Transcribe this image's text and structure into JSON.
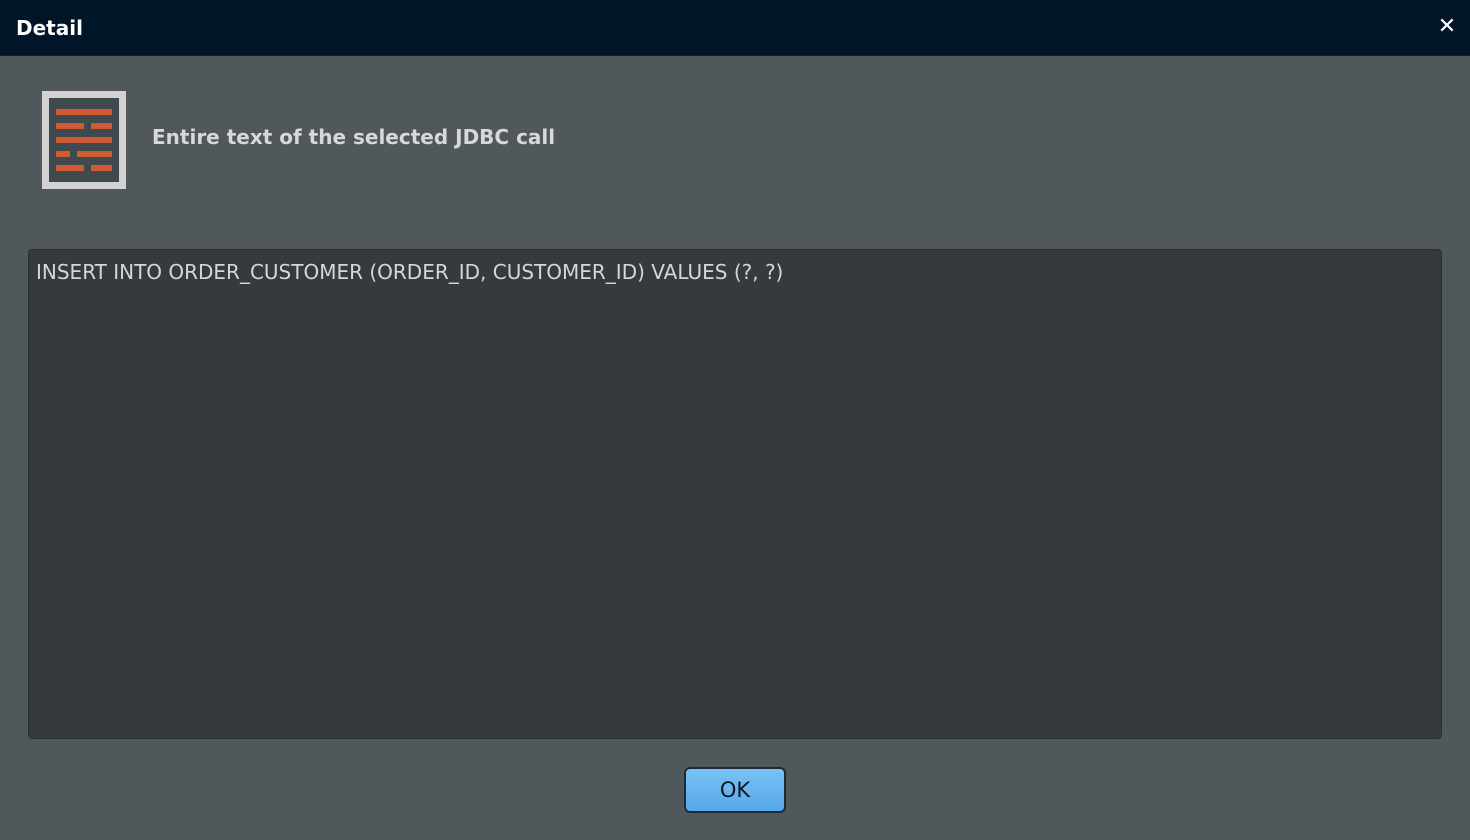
{
  "window": {
    "title": "Detail",
    "close_label": "✕"
  },
  "header": {
    "icon": "document-text-icon",
    "subtitle": "Entire text of the selected JDBC call"
  },
  "content": {
    "text": "INSERT INTO ORDER_CUSTOMER (ORDER_ID, CUSTOMER_ID) VALUES (?, ?)"
  },
  "footer": {
    "ok_label": "OK"
  },
  "colors": {
    "titlebar": "#011528",
    "dialog_bg": "#50585c",
    "text_area_bg": "#353b3d",
    "icon_accent": "#cf5a35",
    "ok_button": "#5aaaf0"
  }
}
